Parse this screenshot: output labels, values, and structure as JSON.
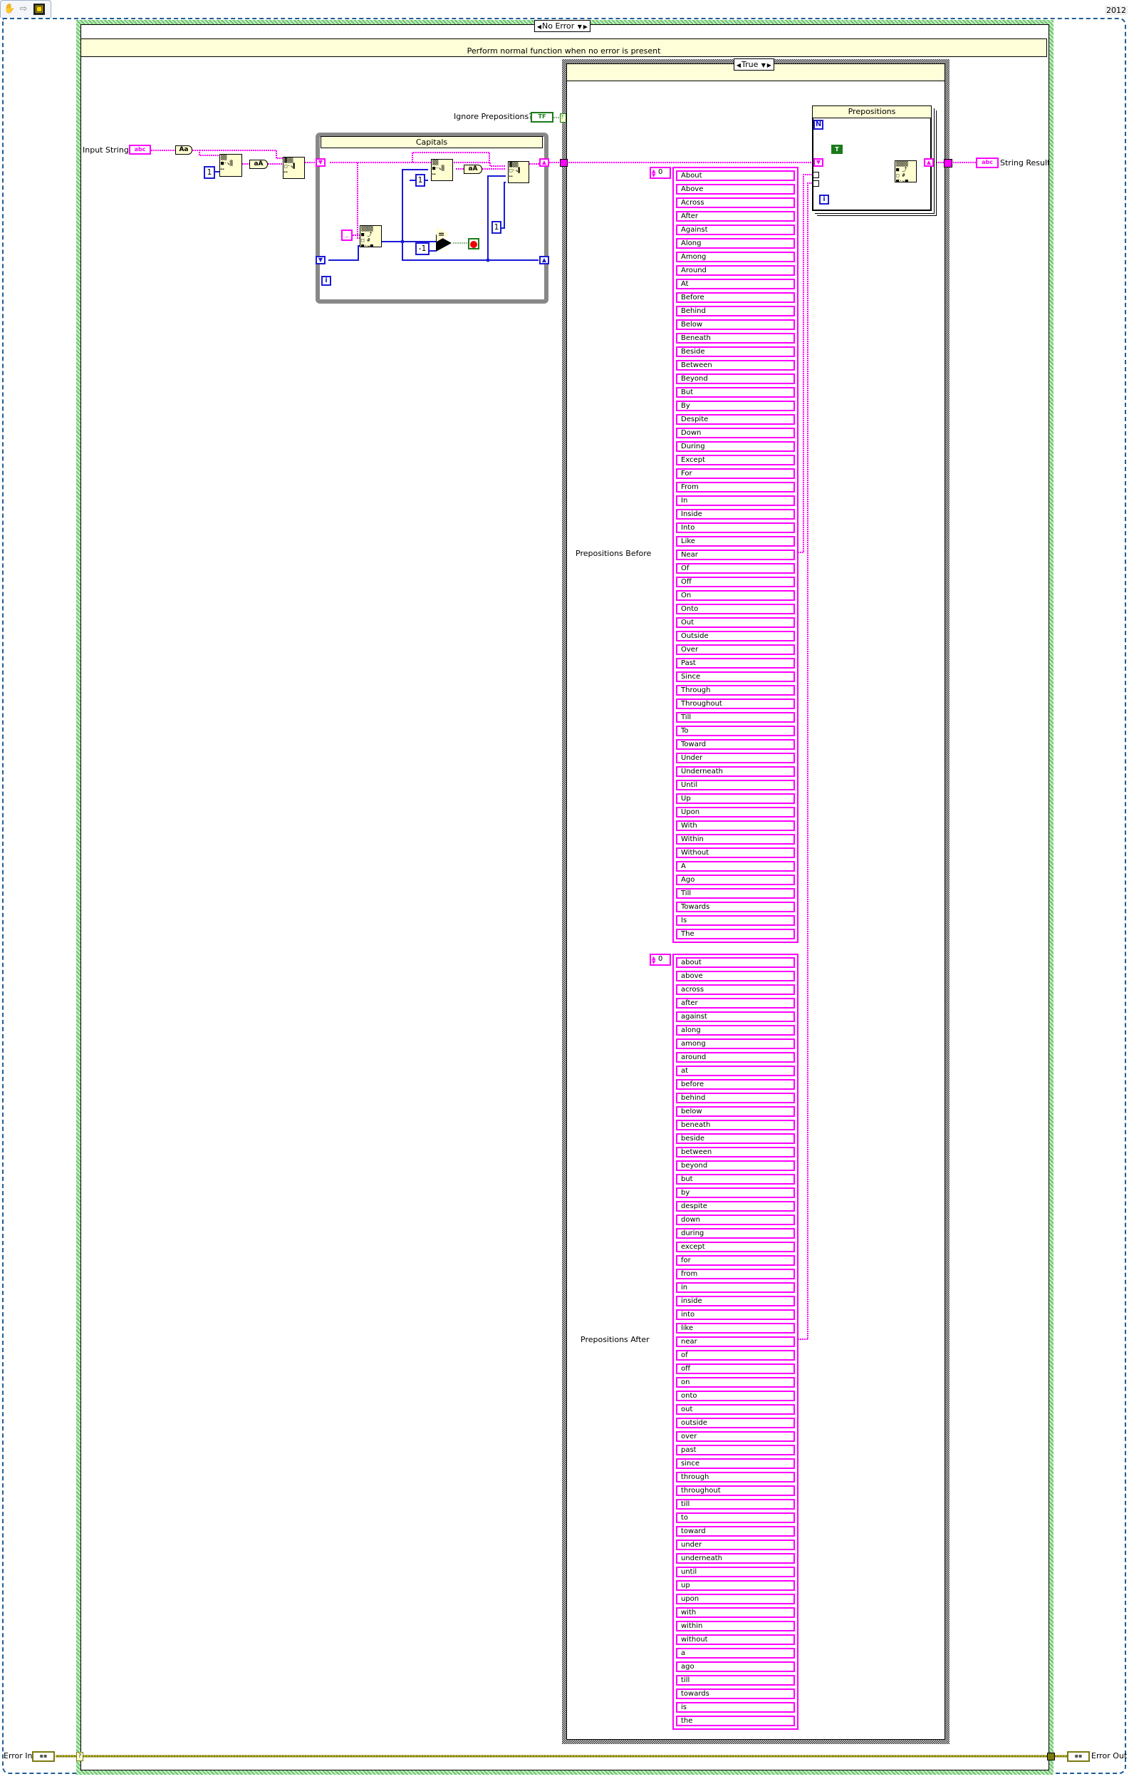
{
  "toolbar": {
    "icons": [
      "hand-tool-icon",
      "run-arrow-icon",
      "vi-icon"
    ],
    "hand_glyph": "✋",
    "arrow_glyph": "⇨",
    "vi_glyph": "▣"
  },
  "version": "2012",
  "error_case": {
    "selector_label": "No Error",
    "comment": "Perform normal function when no error is present"
  },
  "inputs": {
    "input_string_label": "Input String",
    "input_string_glyph": "abc",
    "ignore_prepositions_label": "Ignore Prepositions?",
    "ignore_prepositions_glyph": "TF",
    "error_in_label": "Error In",
    "error_glyph": "▪▪"
  },
  "outputs": {
    "string_result_label": "String Result",
    "string_result_glyph": "abc",
    "error_out_label": "Error Out"
  },
  "pre_loop": {
    "to_upper_glyph": "Aa",
    "to_lower_glyph": "aA",
    "const_one": "1"
  },
  "capitals_loop": {
    "title": "Capitals",
    "space_const": "_",
    "const_one_a": "1",
    "const_one_b": "1",
    "const_minus_one": "-1",
    "equal_glyph": "=",
    "to_lower_glyph": "aA",
    "iteration_glyph": "i"
  },
  "true_case": {
    "selector_label": "True"
  },
  "prepositions_loop": {
    "title": "Prepositions",
    "count_glyph": "N",
    "iteration_glyph": "i",
    "bool_const": "T"
  },
  "prepositions_before": {
    "label": "Prepositions Before",
    "index": "0",
    "items": [
      "About",
      "Above",
      "Across",
      "After",
      "Against",
      "Along",
      "Among",
      "Around",
      "At",
      "Before",
      "Behind",
      "Below",
      "Beneath",
      "Beside",
      "Between",
      "Beyond",
      "But",
      "By",
      "Despite",
      "Down",
      "During",
      "Except",
      "For",
      "From",
      "In",
      "Inside",
      "Into",
      "Like",
      "Near",
      "Of",
      "Off",
      "On",
      "Onto",
      "Out",
      "Outside",
      "Over",
      "Past",
      "Since",
      "Through",
      "Throughout",
      "Till",
      "To",
      "Toward",
      "Under",
      "Underneath",
      "Until",
      "Up",
      "Upon",
      "With",
      "Within",
      "Without",
      "A",
      "Ago",
      "Till",
      "Towards",
      "Is",
      "The"
    ]
  },
  "prepositions_after": {
    "label": "Prepositions After",
    "index": "0",
    "items": [
      "about",
      "above",
      "across",
      "after",
      "against",
      "along",
      "among",
      "around",
      "at",
      "before",
      "behind",
      "below",
      "beneath",
      "beside",
      "between",
      "beyond",
      "but",
      "by",
      "despite",
      "down",
      "during",
      "except",
      "for",
      "from",
      "in",
      "inside",
      "into",
      "like",
      "near",
      "of",
      "off",
      "on",
      "onto",
      "out",
      "outside",
      "over",
      "past",
      "since",
      "through",
      "throughout",
      "till",
      "to",
      "toward",
      "under",
      "underneath",
      "until",
      "up",
      "upon",
      "with",
      "within",
      "without",
      "a",
      "ago",
      "till",
      "towards",
      "is",
      "the"
    ]
  },
  "colors": {
    "string_wire": "#ff00ff",
    "numeric_wire": "#1a1ad6",
    "boolean_wire": "#1a7a1a",
    "error_wire": "#7a7a10",
    "error_case_border": "#8cd48c",
    "comment_bg": "#fefed8",
    "frame_dash": "#1f5f9a"
  }
}
